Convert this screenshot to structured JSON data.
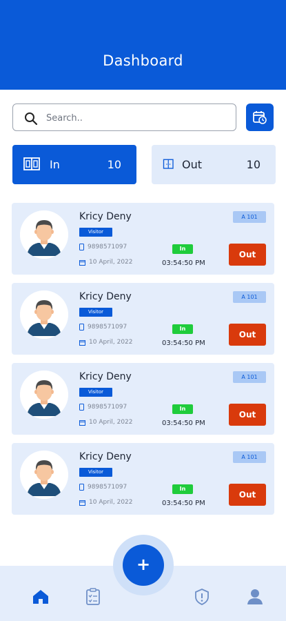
{
  "header": {
    "title": "Dashboard"
  },
  "search": {
    "placeholder": "Search.."
  },
  "stats": {
    "in": {
      "label": "In",
      "count": "10"
    },
    "out": {
      "label": "Out",
      "count": "10"
    }
  },
  "visitors": [
    {
      "name": "Kricy Deny",
      "type": "Visitor",
      "phone": "9898571097",
      "date": "10 April, 2022",
      "room": "A 101",
      "status": "In",
      "time": "03:54:50 PM",
      "action": "Out"
    },
    {
      "name": "Kricy Deny",
      "type": "Visitor",
      "phone": "9898571097",
      "date": "10 April, 2022",
      "room": "A 101",
      "status": "In",
      "time": "03:54:50 PM",
      "action": "Out"
    },
    {
      "name": "Kricy Deny",
      "type": "Visitor",
      "phone": "9898571097",
      "date": "10 April, 2022",
      "room": "A 101",
      "status": "In",
      "time": "03:54:50 PM",
      "action": "Out"
    },
    {
      "name": "Kricy Deny",
      "type": "Visitor",
      "phone": "9898571097",
      "date": "10 April, 2022",
      "room": "A 101",
      "status": "In",
      "time": "03:54:50 PM",
      "action": "Out"
    }
  ],
  "fab": {
    "label": "+"
  },
  "nav": {
    "items": [
      "home-icon",
      "clipboard-icon",
      "shield-icon",
      "user-icon"
    ]
  },
  "colors": {
    "primary": "#0a5ad8",
    "card": "#e4edfb",
    "in_badge": "#1fcc3b",
    "out_button": "#d93a0c",
    "room_badge": "#a9c8f5"
  }
}
